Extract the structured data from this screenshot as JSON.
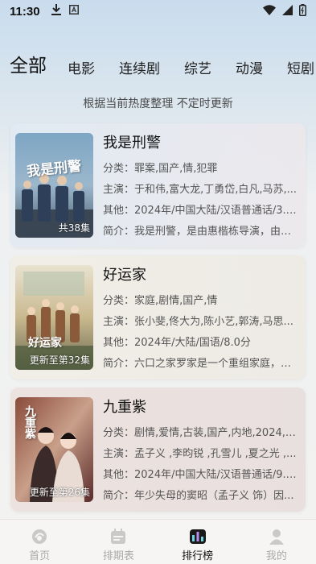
{
  "status": {
    "time": "11:30"
  },
  "tabs": [
    {
      "label": "全部"
    },
    {
      "label": "电影"
    },
    {
      "label": "连续剧"
    },
    {
      "label": "综艺"
    },
    {
      "label": "动漫"
    },
    {
      "label": "短剧"
    }
  ],
  "subtitle": "根据当前热度整理 不定时更新",
  "items": [
    {
      "title": "我是刑警",
      "episode": "共38集",
      "poster_text": "我是刑警",
      "genre": "分类：罪案,国产,情,犯罪",
      "cast": "主演：于和伟,富大龙,丁勇岱,白凡,马苏,...",
      "other": "其他：2024年/中国大陆/汉语普通话/3.0...",
      "intro": "简介：我是刑警，是由惠楷栋导演，由于..."
    },
    {
      "title": "好运家",
      "episode": "更新至第32集",
      "poster_text": "好运家",
      "genre": "分类：家庭,剧情,国产,情",
      "cast": "主演：张小斐,佟大为,陈小艺,郭涛,马思...",
      "other": "其他：2024年/大陆/国语/8.0分",
      "intro": "简介：六口之家罗家是一个重组家庭，日..."
    },
    {
      "title": "九重紫",
      "episode": "更新至第26集",
      "poster_text": "九重紫",
      "genre": "分类：剧情,爱情,古装,国产,内地,2024,古...",
      "cast": "主演：孟子义 ,李昀锐 ,孔雪儿 ,夏之光 ,...",
      "other": "其他：2024年/中国大陆/汉语普通话/9.0...",
      "intro": "简介：年少失母的窦昭（孟子义 饰）因..."
    }
  ],
  "nav": [
    {
      "label": "首页",
      "icon": "home-icon"
    },
    {
      "label": "排期表",
      "icon": "calendar-icon"
    },
    {
      "label": "排行榜",
      "icon": "ranking-icon"
    },
    {
      "label": "我的",
      "icon": "profile-icon"
    }
  ]
}
